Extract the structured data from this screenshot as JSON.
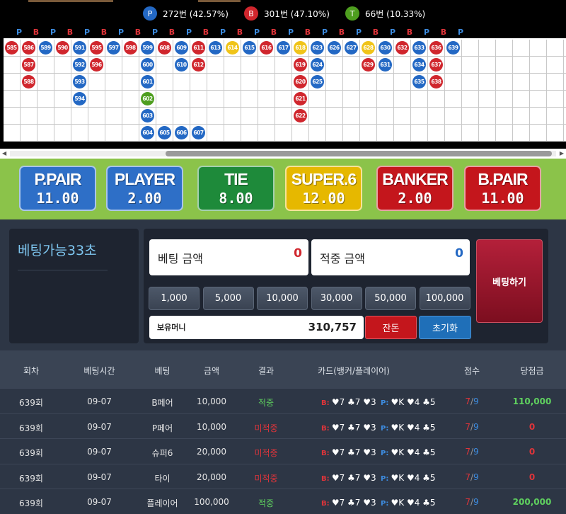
{
  "stats": {
    "player": {
      "icon": "P",
      "text": "272번 (42.57%)",
      "color": "#2368c4"
    },
    "banker": {
      "icon": "B",
      "text": "301번 (47.10%)",
      "color": "#d0262d"
    },
    "tie": {
      "icon": "T",
      "text": "66번 (10.33%)",
      "color": "#4e9e1f"
    }
  },
  "road": {
    "header": [
      "P",
      "B",
      "P",
      "B",
      "P",
      "B",
      "P",
      "B",
      "P",
      "B",
      "P",
      "B",
      "P",
      "B",
      "P",
      "B",
      "P",
      "B",
      "P",
      "B",
      "P",
      "B",
      "P",
      "B",
      "P",
      "B",
      "P"
    ],
    "columns": [
      [
        {
          "n": "585",
          "c": "B"
        }
      ],
      [
        {
          "n": "586",
          "c": "B"
        },
        {
          "n": "587",
          "c": "B"
        },
        {
          "n": "588",
          "c": "B"
        }
      ],
      [
        {
          "n": "589",
          "c": "P"
        }
      ],
      [
        {
          "n": "590",
          "c": "B"
        }
      ],
      [
        {
          "n": "591",
          "c": "P"
        },
        {
          "n": "592",
          "c": "P"
        },
        {
          "n": "593",
          "c": "P"
        },
        {
          "n": "594",
          "c": "P"
        }
      ],
      [
        {
          "n": "595",
          "c": "B"
        },
        {
          "n": "596",
          "c": "B"
        }
      ],
      [
        {
          "n": "597",
          "c": "P"
        }
      ],
      [
        {
          "n": "598",
          "c": "B"
        }
      ],
      [
        {
          "n": "599",
          "c": "P"
        },
        {
          "n": "600",
          "c": "P"
        },
        {
          "n": "601",
          "c": "P"
        },
        {
          "n": "602",
          "c": "T"
        },
        {
          "n": "603",
          "c": "P"
        },
        {
          "n": "604",
          "c": "P"
        }
      ],
      [
        {
          "n": "608",
          "c": "B"
        }
      ],
      [
        {
          "n": "609",
          "c": "P"
        },
        {
          "n": "610",
          "c": "P"
        }
      ],
      [
        {
          "n": "611",
          "c": "B"
        },
        {
          "n": "612",
          "c": "B"
        }
      ],
      [
        {
          "n": "613",
          "c": "P"
        }
      ],
      [
        {
          "n": "614",
          "c": "S"
        }
      ],
      [
        {
          "n": "615",
          "c": "P"
        }
      ],
      [
        {
          "n": "616",
          "c": "B"
        }
      ],
      [
        {
          "n": "617",
          "c": "P"
        }
      ],
      [
        {
          "n": "618",
          "c": "S"
        },
        {
          "n": "619",
          "c": "B"
        },
        {
          "n": "620",
          "c": "B"
        },
        {
          "n": "621",
          "c": "B"
        },
        {
          "n": "622",
          "c": "B"
        }
      ],
      [
        {
          "n": "623",
          "c": "P"
        },
        {
          "n": "624",
          "c": "P"
        },
        {
          "n": "625",
          "c": "P"
        }
      ],
      [
        {
          "n": "626",
          "c": "P"
        }
      ],
      [
        {
          "n": "627",
          "c": "P"
        }
      ],
      [
        {
          "n": "628",
          "c": "S"
        },
        {
          "n": "629",
          "c": "B"
        }
      ],
      [
        {
          "n": "630",
          "c": "P"
        },
        {
          "n": "631",
          "c": "P"
        }
      ],
      [
        {
          "n": "632",
          "c": "B"
        }
      ],
      [
        {
          "n": "633",
          "c": "P"
        },
        {
          "n": "634",
          "c": "P"
        },
        {
          "n": "635",
          "c": "P"
        }
      ],
      [
        {
          "n": "636",
          "c": "B"
        },
        {
          "n": "637",
          "c": "B"
        },
        {
          "n": "638",
          "c": "B"
        }
      ],
      [
        {
          "n": "639",
          "c": "P"
        }
      ]
    ],
    "dragon": [
      {
        "n": "605",
        "c": "P"
      },
      {
        "n": "606",
        "c": "P"
      },
      {
        "n": "607",
        "c": "P"
      }
    ]
  },
  "tabs": [
    {
      "name": "P.PAIR",
      "odds": "11.00",
      "color": "#2e6fc7"
    },
    {
      "name": "PLAYER",
      "odds": "2.00",
      "color": "#2e6fc7"
    },
    {
      "name": "TIE",
      "odds": "8.00",
      "color": "#1e8a3a"
    },
    {
      "name": "SUPER.6",
      "odds": "12.00",
      "color": "#e6b800"
    },
    {
      "name": "BANKER",
      "odds": "2.00",
      "color": "#c4161c"
    },
    {
      "name": "B.PAIR",
      "odds": "11.00",
      "color": "#c4161c"
    }
  ],
  "panel": {
    "timer": "베팅가능33초",
    "bet_label": "베팅 금액",
    "bet_value": "0",
    "win_label": "적중 금액",
    "win_value": "0",
    "chips": [
      "1,000",
      "5,000",
      "10,000",
      "30,000",
      "50,000",
      "100,000"
    ],
    "balance_label": "보유머니",
    "balance_value": "310,757",
    "change_button": "잔돈",
    "reset_button": "초기화",
    "bet_button": "베팅하기"
  },
  "history": {
    "headers": [
      "회차",
      "베팅시간",
      "베팅",
      "금액",
      "결과",
      "카드(뱅커/플레이어)",
      "점수",
      "당첨금"
    ],
    "rows": [
      {
        "round": "639회",
        "time": "09-07",
        "bet": "B페어",
        "amount": "10,000",
        "result": "적중",
        "win": true,
        "bank": "B:",
        "bcards": "♥7 ♣7 ♥3",
        "play": "P:",
        "pcards": "♥K ♥4 ♣5",
        "s1": "7",
        "s2": "9",
        "payout": "110,000"
      },
      {
        "round": "639회",
        "time": "09-07",
        "bet": "P페어",
        "amount": "10,000",
        "result": "미적중",
        "win": false,
        "bank": "B:",
        "bcards": "♥7 ♣7 ♥3",
        "play": "P:",
        "pcards": "♥K ♥4 ♣5",
        "s1": "7",
        "s2": "9",
        "payout": "0"
      },
      {
        "round": "639회",
        "time": "09-07",
        "bet": "슈퍼6",
        "amount": "20,000",
        "result": "미적중",
        "win": false,
        "bank": "B:",
        "bcards": "♥7 ♣7 ♥3",
        "play": "P:",
        "pcards": "♥K ♥4 ♣5",
        "s1": "7",
        "s2": "9",
        "payout": "0"
      },
      {
        "round": "639회",
        "time": "09-07",
        "bet": "타이",
        "amount": "20,000",
        "result": "미적중",
        "win": false,
        "bank": "B:",
        "bcards": "♥7 ♣7 ♥3",
        "play": "P:",
        "pcards": "♥K ♥4 ♣5",
        "s1": "7",
        "s2": "9",
        "payout": "0"
      },
      {
        "round": "639회",
        "time": "09-07",
        "bet": "플레이어",
        "amount": "100,000",
        "result": "적중",
        "win": true,
        "bank": "B:",
        "bcards": "♥7 ♣7 ♥3",
        "play": "P:",
        "pcards": "♥K ♥4 ♣5",
        "s1": "7",
        "s2": "9",
        "payout": "200,000"
      }
    ]
  }
}
